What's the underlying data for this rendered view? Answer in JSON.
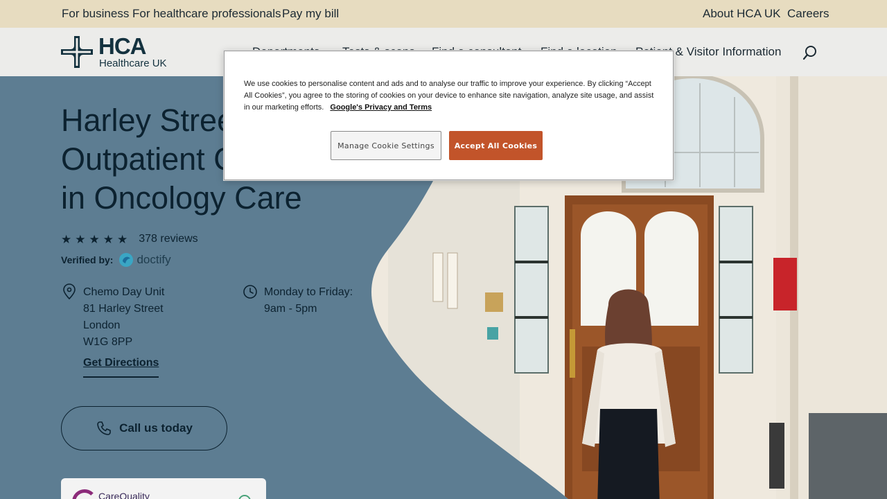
{
  "utility_bar": {
    "left_links": [
      "For business",
      "For healthcare professionals",
      "Pay my bill"
    ],
    "right_links": [
      "About HCA UK",
      "Careers"
    ]
  },
  "header": {
    "logo_name": "HCA",
    "logo_sub": "Healthcare UK",
    "nav": [
      "Departments",
      "Tests & scans",
      "Find a consultant",
      "Find a location",
      "Patient & Visitor Information"
    ],
    "search_icon": "search-icon"
  },
  "hero": {
    "title_lines": [
      "Harley Street",
      "Outpatient Centre",
      "in Oncology Care"
    ],
    "rating": {
      "stars": 5,
      "max": 5,
      "reviews_label": "378 reviews"
    },
    "verified_label": "Verified by:",
    "verified_brand": "doctify",
    "address_lines": [
      "Chemo Day Unit",
      "81 Harley Street",
      "London",
      "W1G 8PP"
    ],
    "directions_label": "Get Directions",
    "hours_lines": [
      "Monday to Friday:",
      "9am - 5pm"
    ],
    "call_label": "Call us today",
    "cqc_label": "CareQuality"
  },
  "cookie": {
    "text": "We use cookies to personalise content and ads and to analyse our traffic to improve your experience. By clicking “Accept All Cookies”, you agree to the storing of cookies on your device to enhance site navigation, analyze site usage, and assist in our marketing efforts.",
    "link_label": "Google's Privacy and Terms",
    "manage_label": "Manage Cookie Settings",
    "accept_label": "Accept All Cookies"
  },
  "colors": {
    "utility_bg": "#e7dcc0",
    "header_bg": "#ececea",
    "hero_bg": "#5d7d92",
    "brand_navy": "#14323f",
    "accept_button": "#c2542a"
  }
}
